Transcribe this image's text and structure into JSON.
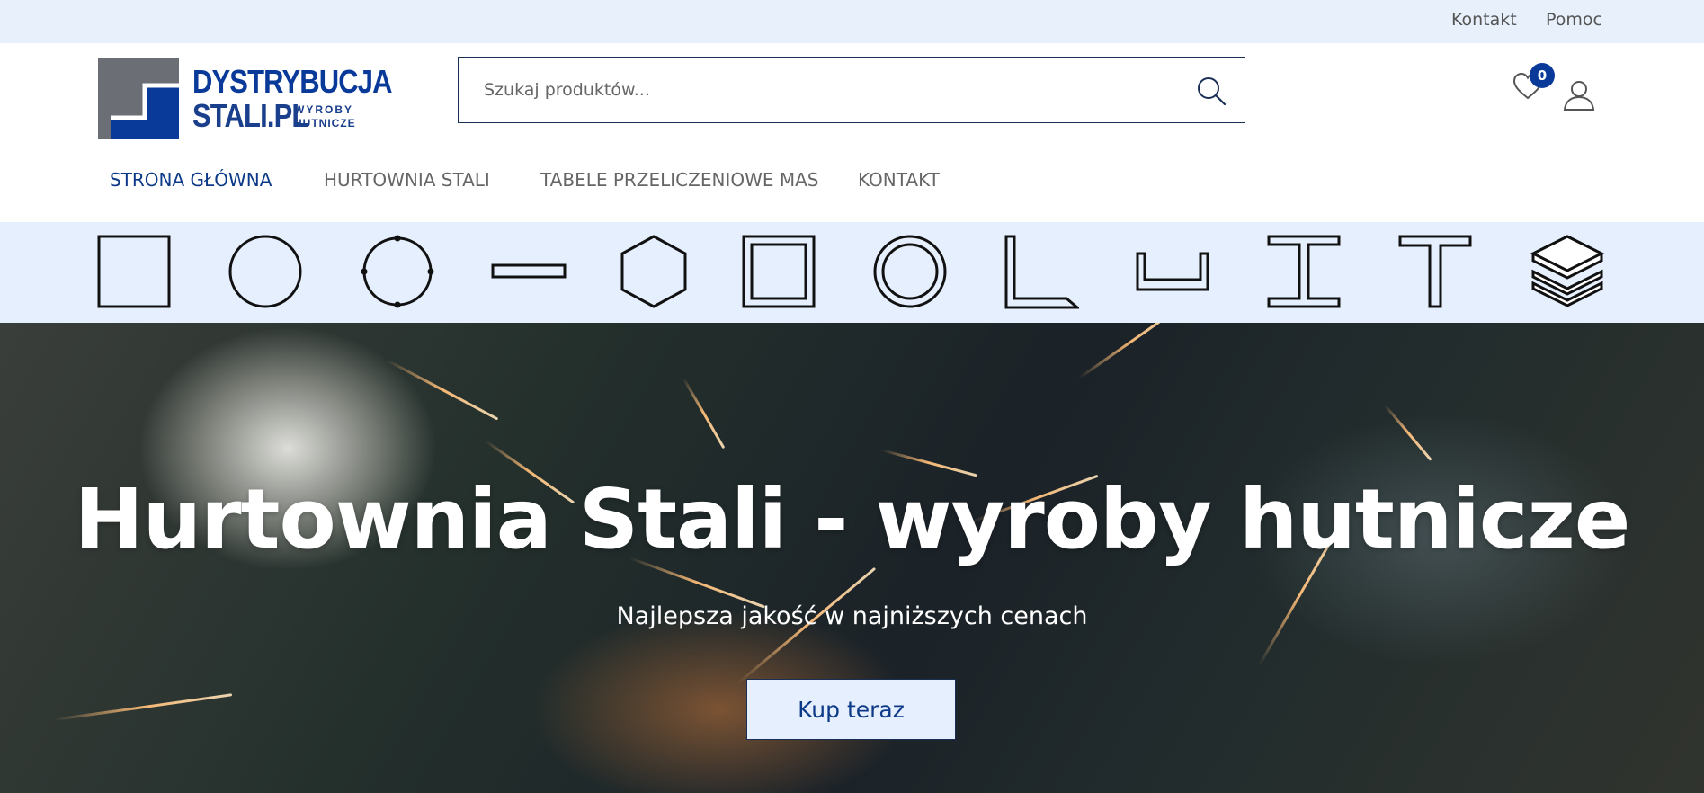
{
  "topbar": {
    "links": [
      {
        "label": "Kontakt"
      },
      {
        "label": "Pomoc"
      }
    ]
  },
  "logo": {
    "line1": "DYSTRYBUCJA",
    "line2": "STALI.PL",
    "tag1": "WYROBY",
    "tag2": "HUTNICZE",
    "colors": {
      "gray": "#6b6e74",
      "blue": "#0a3a99"
    }
  },
  "search": {
    "placeholder": "Szukaj produktów...",
    "icon": "search-icon"
  },
  "wishlist": {
    "icon": "heart-icon",
    "count": "0"
  },
  "account": {
    "icon": "user-icon"
  },
  "nav": {
    "items": [
      {
        "label": "STRONA GŁÓWNA",
        "active": true
      },
      {
        "label": "HURTOWNIA STALI",
        "active": false
      },
      {
        "label": "TABELE PRZELICZENIOWE MAS",
        "active": false
      },
      {
        "label": "KONTAKT",
        "active": false
      }
    ]
  },
  "categories": {
    "icons": [
      "square-bar-icon",
      "round-bar-icon",
      "round-tube-icon",
      "flat-bar-icon",
      "hexagon-bar-icon",
      "square-tube-icon",
      "circular-pipe-icon",
      "angle-profile-icon",
      "channel-profile-icon",
      "i-beam-icon",
      "t-profile-icon",
      "sheet-layers-icon"
    ]
  },
  "hero": {
    "title": "Hurtownia Stali - wyroby hutnicze",
    "subtitle": "Najlepsza jakość w najniższych cenach",
    "button": "Kup teraz"
  },
  "colors": {
    "accent": "#0a3a99",
    "topbar_bg": "#e8f0fc",
    "strip_bg": "#e6effd"
  }
}
